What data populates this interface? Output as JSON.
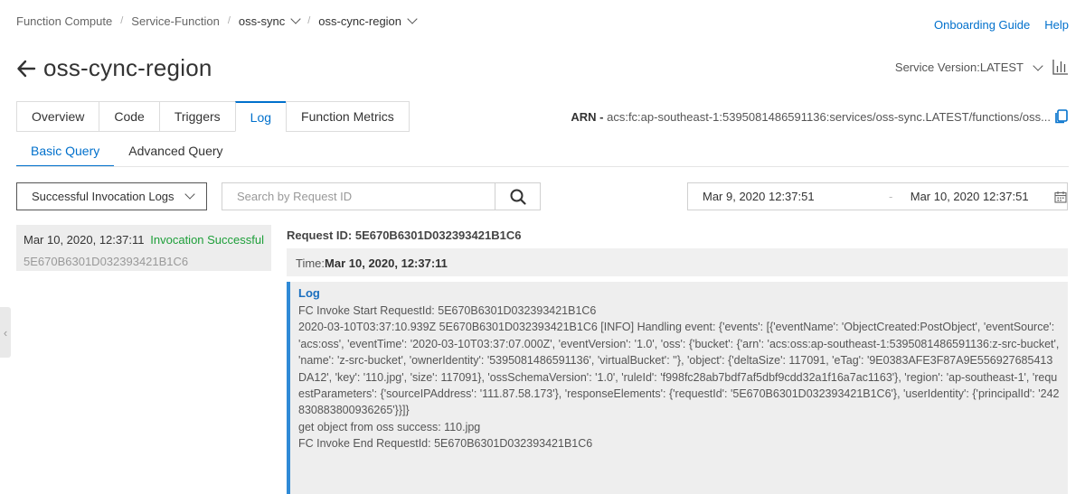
{
  "breadcrumb": {
    "items": [
      "Function Compute",
      "Service-Function",
      "oss-sync",
      "oss-cync-region"
    ],
    "separator": "/"
  },
  "header": {
    "links": [
      "Onboarding Guide",
      "Help"
    ],
    "title": "oss-cync-region",
    "version_label": "Service Version:LATEST"
  },
  "tabs": [
    "Overview",
    "Code",
    "Triggers",
    "Log",
    "Function Metrics"
  ],
  "active_tab": "Log",
  "arn": {
    "label": "ARN -",
    "value": " acs:fc:ap-southeast-1:5395081486591136:services/oss-sync.LATEST/functions/oss..."
  },
  "subtabs": [
    "Basic Query",
    "Advanced Query"
  ],
  "filter": {
    "log_type": "Successful Invocation Logs",
    "search_placeholder": "Search by Request ID",
    "date_start": "Mar 9, 2020 12:37:51",
    "date_separator": "-",
    "date_end": "Mar 10, 2020 12:37:51"
  },
  "requests": [
    {
      "time": "Mar 10, 2020, 12:37:11",
      "status": "Invocation Successful",
      "id": "5E670B6301D032393421B1C6"
    }
  ],
  "detail": {
    "request_id_label": "Request ID: 5E670B6301D032393421B1C6",
    "time_label": "Time:",
    "time_value": "Mar 10, 2020, 12:37:11",
    "log_title": "Log",
    "log_lines": [
      "FC Invoke Start RequestId: 5E670B6301D032393421B1C6",
      "2020-03-10T03:37:10.939Z 5E670B6301D032393421B1C6 [INFO] Handling event: {'events': [{'eventName': 'ObjectCreated:PostObject', 'eventSource': 'acs:oss', 'eventTime': '2020-03-10T03:37:07.000Z', 'eventVersion': '1.0', 'oss': {'bucket': {'arn': 'acs:oss:ap-southeast-1:5395081486591136:z-src-bucket', 'name': 'z-src-bucket', 'ownerIdentity': '5395081486591136', 'virtualBucket': ''}, 'object': {'deltaSize': 117091, 'eTag': '9E0383AFE3F87A9E556927685413DA12', 'key': '110.jpg', 'size': 117091}, 'ossSchemaVersion': '1.0', 'ruleId': 'f998fc28ab7bdf7af5dbf9cdd32a1f16a7ac1163'}, 'region': 'ap-southeast-1', 'requestParameters': {'sourceIPAddress': '111.87.58.173'}, 'responseElements': {'requestId': '5E670B6301D032393421B1C6'}, 'userIdentity': {'principalId': '242830883800936265'}}]}",
      "get object from oss success: 110.jpg",
      "FC Invoke End RequestId: 5E670B6301D032393421B1C6"
    ]
  },
  "colors": {
    "accent": "#0070cc",
    "success": "#1e9f3a",
    "log_border": "#2f8ad6"
  }
}
